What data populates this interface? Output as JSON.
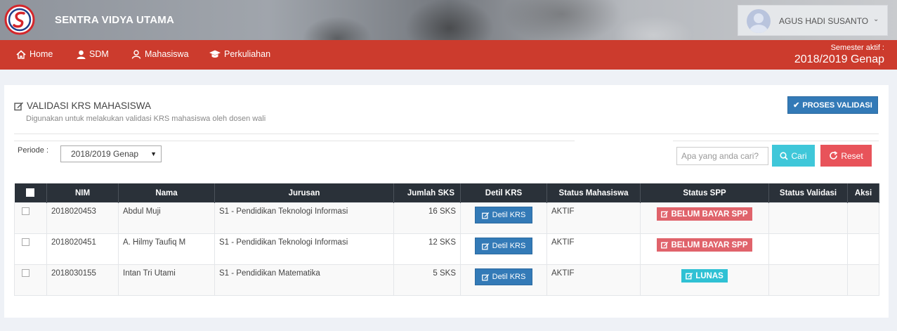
{
  "header": {
    "brand": "SENTRA VIDYA UTAMA",
    "user_name": "AGUS HADI SUSANTO"
  },
  "nav": {
    "items": [
      {
        "label": "Home",
        "icon": "home-icon"
      },
      {
        "label": "SDM",
        "icon": "user-icon"
      },
      {
        "label": "Mahasiswa",
        "icon": "users-icon"
      },
      {
        "label": "Perkuliahan",
        "icon": "graduation-cap-icon"
      }
    ],
    "semester_label": "Semester aktif :",
    "semester_value": "2018/2019 Genap"
  },
  "page": {
    "title": "VALIDASI KRS MAHASISWA",
    "subtitle": "Digunakan untuk melakukan validasi KRS mahasiswa oleh dosen wali",
    "proses_button": "PROSES VALIDASI"
  },
  "filter": {
    "periode_label": "Periode :",
    "periode_value": "2018/2019 Genap",
    "search_placeholder": "Apa yang anda cari?",
    "cari_label": "Cari",
    "reset_label": "Reset"
  },
  "table": {
    "headers": [
      "NIM",
      "Nama",
      "Jurusan",
      "Jumlah SKS",
      "Detil KRS",
      "Status Mahasiswa",
      "Status SPP",
      "Status Validasi",
      "Aksi"
    ],
    "detil_label": "Detil KRS",
    "rows": [
      {
        "nim": "2018020453",
        "nama": "Abdul Muji",
        "jurusan": "S1 - Pendidikan Teknologi Informasi",
        "sks": "16 SKS",
        "status_mhs": "AKTIF",
        "spp": "BELUM BAYAR SPP"
      },
      {
        "nim": "2018020451",
        "nama": "A. Hilmy Taufiq M",
        "jurusan": "S1 - Pendidikan Teknologi Informasi",
        "sks": "12 SKS",
        "status_mhs": "AKTIF",
        "spp": "BELUM BAYAR SPP"
      },
      {
        "nim": "2018030155",
        "nama": "Intan Tri Utami",
        "jurusan": "S1 - Pendidikan Matematika",
        "sks": "5 SKS",
        "status_mhs": "AKTIF",
        "spp": "LUNAS"
      }
    ]
  },
  "colors": {
    "nav_red": "#cc3b2d",
    "primary_blue": "#337ab7",
    "badge_danger": "#e0636b",
    "badge_info": "#2fc1d4",
    "table_header": "#2a3139"
  }
}
